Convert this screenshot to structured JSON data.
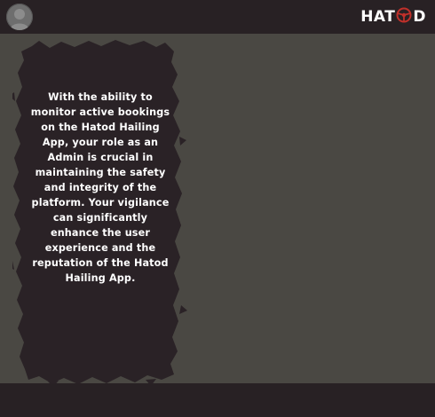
{
  "header": {
    "avatar_icon": "user-avatar-icon",
    "logo": {
      "text_left": "HAT",
      "text_right": "D",
      "wheel_icon": "steering-wheel-icon",
      "wheel_color": "#c0302a"
    }
  },
  "main": {
    "message": "With the ability to monitor active bookings on the Hatod Hailing App, your role as an Admin is crucial in maintaining the safety and integrity of the platform. Your vigilance can significantly enhance the user experience and the reputation of the Hatod Hailing App."
  },
  "colors": {
    "bars": "#282124",
    "background": "#4a4843",
    "brush": "#2a2226",
    "text": "#ffffff"
  }
}
